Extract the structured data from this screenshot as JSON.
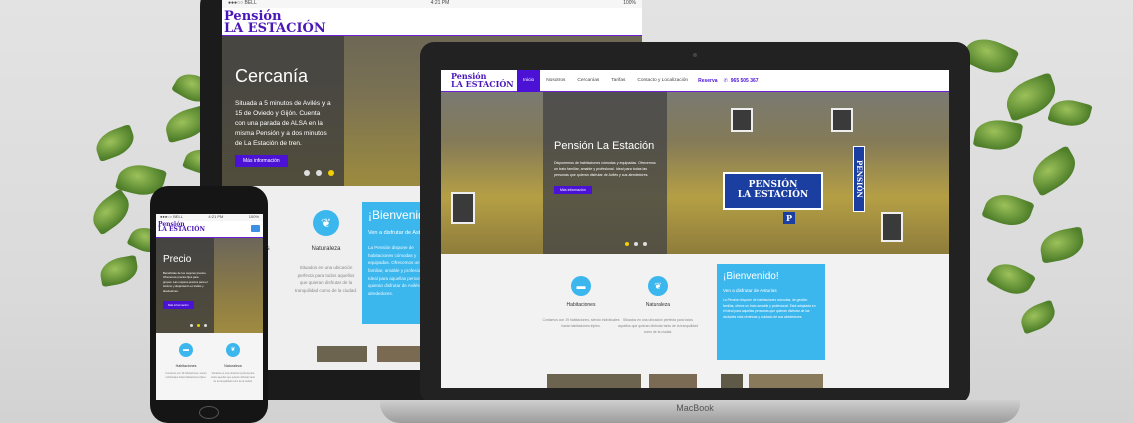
{
  "brand": {
    "line1": "Pensión",
    "line2": "LA ESTACIÓN"
  },
  "status": {
    "carrier": "●●●○○ BELL",
    "time": "4:21 PM",
    "battery": "100%"
  },
  "tablet": {
    "hero_title": "Cercanía",
    "hero_text": "Situada a 5 minutos de Avilés y a 15 de Oviedo y Gijón. Cuenta con una parada de ALSA en la misma Pensión y a dos minutos de La Estación de tren.",
    "button": "Más información",
    "section_icon": "leaf-icon",
    "feature_partial": "les",
    "feature_title": "Naturaleza",
    "feature_text": "Situados en una ubicación perfecta para todos aquellos que quieran disfrutar de la tranquilidad como de la ciudad.",
    "welcome_title": "¡Bienvenido!",
    "welcome_sub": "Ven a disfrutar de Asturias",
    "welcome_text": "La Pensión dispone de habitaciones cómodas y equipadas. Ofrecemos un trato familiar, amable y profesional. Ideal para aquellas personas que quieran disfrutar de Avilés y sus alrededores."
  },
  "laptop": {
    "menu": [
      "Inicio",
      "Nosotros",
      "Cercanías",
      "Tarifas",
      "Contacto y Localización"
    ],
    "reserva_label": "Reserva",
    "phone_icon": "phone-icon",
    "phone_number": "965 505 367",
    "hero_title": "Pensión La Estación",
    "hero_text": "Disponemos de habitaciones cómodas y equipadas. Ofrecemos un trato familiar, amable y profesional. Ideal para todas las personas que quieran disfrutar de Avilés y sus alrededores.",
    "button": "Más información",
    "sign_line1": "PENSIÓN",
    "sign_line2": "LA ESTACIÓN",
    "sign_side": "PENSIÓN",
    "parking": "P",
    "features": [
      {
        "icon": "bed-icon",
        "title": "Habitaciones",
        "text": "Contamos con 19 habitaciones, siendo individuales hasta habitaciones triples."
      },
      {
        "icon": "leaf-icon",
        "title": "Naturaleza",
        "text": "Situados en una ubicación perfecta para todos aquellos que quieran disfrutar tanto de la tranquilidad como de la ciudad."
      }
    ],
    "welcome_title": "¡Bienvenido!",
    "welcome_sub": "Ven a disfrutar de Asturias",
    "welcome_text": "La Pensión dispone de habitaciones cómodas, de gestión familiar, ofrece un trato amable y profesional. Está adaptada en el ideal para aquellas personas que quieran disfrutar de las ciudades más céntricas y cuidado de sus alrededores.",
    "base_label": "MacBook"
  },
  "phone": {
    "hero_title": "Precio",
    "hero_text": "Beneficiate de los mejores precios. Ofrecemos precios fijos para grupos. Las mejores precios para el turismo y alojamiento en Avilés y alrededores.",
    "button": "Más información",
    "features": [
      {
        "icon": "bed-icon",
        "title": "Habitaciones",
        "text": "Contamos con 19 habitaciones, siendo individuales hasta habitaciones triples."
      },
      {
        "icon": "leaf-icon",
        "title": "Naturaleza",
        "text": "Situados en una ubicación perfecta para todos aquellos que quieran disfrutar tanto de la tranquilidad como de la ciudad."
      }
    ]
  },
  "colors": {
    "brand_purple": "#4b12d6",
    "accent_blue": "#3cb7ee",
    "slider_active": "#f0d000"
  }
}
